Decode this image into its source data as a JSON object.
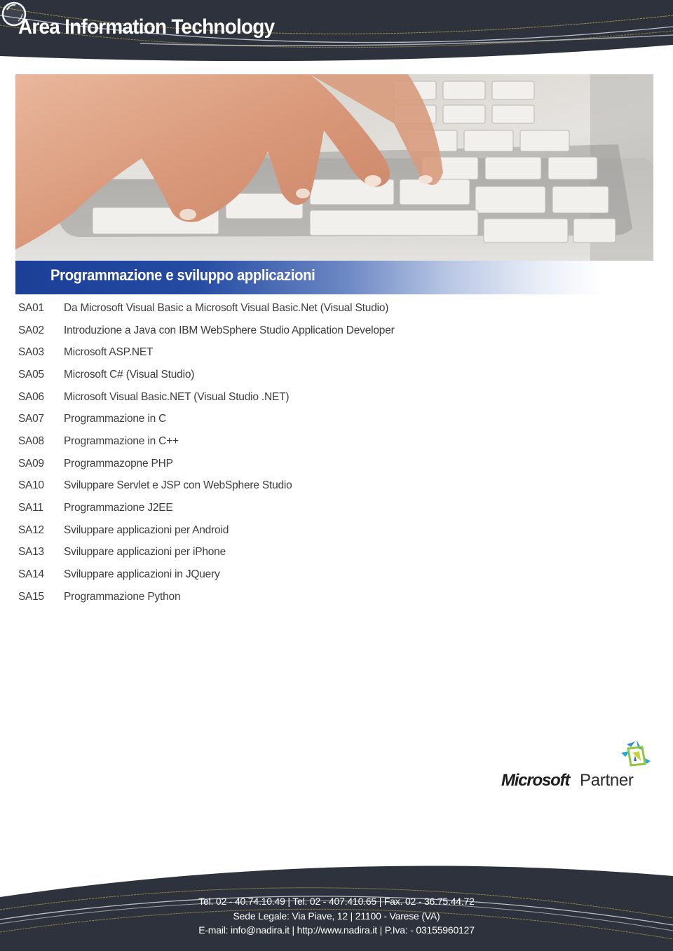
{
  "header": {
    "title": "Area Information Technology",
    "background_color": "#2d323d",
    "decor_icon": "glass-bubble-icon"
  },
  "photo": {
    "description": "hands typing on silver laptop keyboard"
  },
  "section": {
    "title": "Programmazione e sviluppo applicazioni",
    "accent_color": "#1c3f98"
  },
  "courses": [
    {
      "code": "SA01",
      "title": "Da Microsoft Visual Basic a Microsoft Visual Basic.Net (Visual Studio)"
    },
    {
      "code": "SA02",
      "title": "Introduzione a Java con IBM WebSphere Studio Application Developer"
    },
    {
      "code": "SA03",
      "title": "Microsoft ASP.NET"
    },
    {
      "code": "SA05",
      "title": "Microsoft C# (Visual Studio)"
    },
    {
      "code": "SA06",
      "title": "Microsoft Visual Basic.NET (Visual Studio .NET)"
    },
    {
      "code": "SA07",
      "title": "Programmazione in C"
    },
    {
      "code": "SA08",
      "title": "Programmazione in C++"
    },
    {
      "code": "SA09",
      "title": "Programmazopne PHP"
    },
    {
      "code": "SA10",
      "title": "Sviluppare Servlet e JSP con WebSphere Studio"
    },
    {
      "code": "SA11",
      "title": "Programmazione J2EE"
    },
    {
      "code": "SA12",
      "title": "Sviluppare applicazioni per Android"
    },
    {
      "code": "SA13",
      "title": "Sviluppare applicazioni per iPhone"
    },
    {
      "code": "SA14",
      "title": "Sviluppare applicazioni in JQuery"
    },
    {
      "code": "SA15",
      "title": "Programmazione Python"
    }
  ],
  "partner_logo": {
    "brand": "Microsoft",
    "suffix": "Partner"
  },
  "footer": {
    "line1": "Tel. 02 - 40.74.10.49 | Tel. 02 - 407.410.65 | Fax. 02 - 36.75.44.72",
    "line2": "Sede Legale: Via Piave, 12 | 21100 - Varese (VA)",
    "line3": "E-mail: info@nadira.it | http://www.nadira.it | P.Iva: - 03155960127"
  }
}
